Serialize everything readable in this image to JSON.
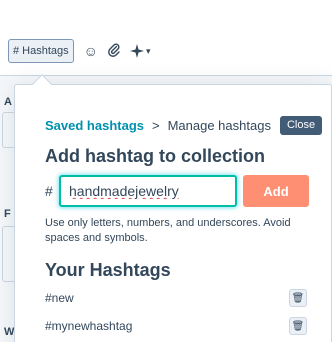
{
  "toolbar": {
    "hashtags_label": "# Hashtags",
    "emoji_icon": "smiley-icon",
    "attach_icon": "paperclip-icon",
    "ai_icon": "sparkle-icon",
    "dropdown_caret": "▾"
  },
  "background_form": {
    "label_a": "A",
    "label_f": "F",
    "label_w": "W"
  },
  "popover": {
    "breadcrumb": {
      "link": "Saved hashtags",
      "separator": ">",
      "current": "Manage hashtags"
    },
    "close_label": "Close",
    "add_title": "Add hashtag to collection",
    "hash_prefix": "#",
    "input_value": "handmadejewelry",
    "add_label": "Add",
    "help_text": "Use only letters, numbers, and underscores. Avoid spaces and symbols.",
    "your_title": "Your Hashtags",
    "hashtags": [
      {
        "tag": "#new"
      },
      {
        "tag": "#mynewhashtag"
      }
    ]
  },
  "colors": {
    "link": "#0091ae",
    "close_bg": "#425b76",
    "add_bg": "#ff8f73",
    "input_focus": "#00bda5"
  }
}
